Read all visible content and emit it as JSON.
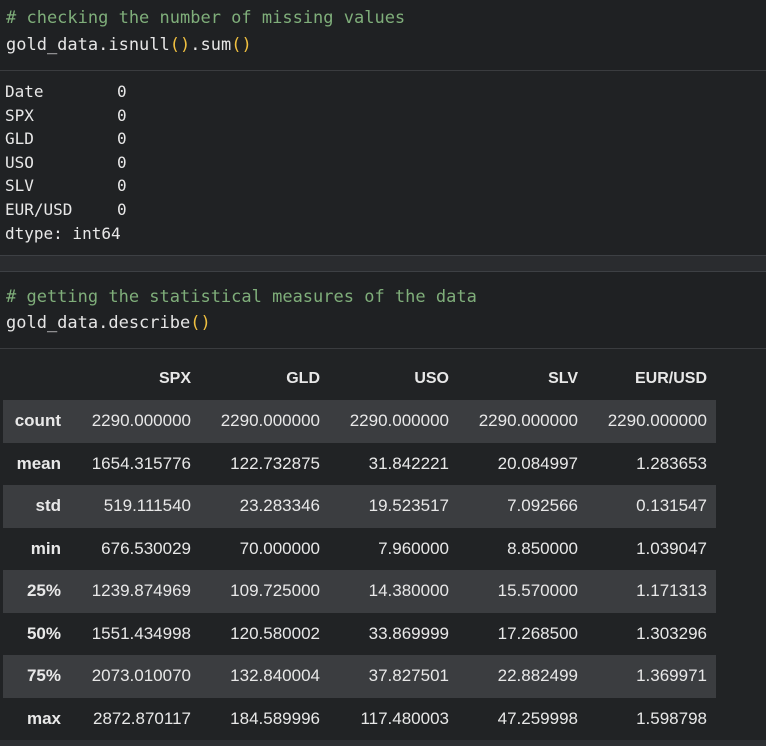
{
  "cell1": {
    "comment": "# checking the number of missing values",
    "code_obj": "gold_data.isnull",
    "code_mid": ".sum",
    "paren": "()"
  },
  "output1": {
    "rows": [
      {
        "name": "Date",
        "value": "0"
      },
      {
        "name": "SPX",
        "value": "0"
      },
      {
        "name": "GLD",
        "value": "0"
      },
      {
        "name": "USO",
        "value": "0"
      },
      {
        "name": "SLV",
        "value": "0"
      },
      {
        "name": "EUR/USD",
        "value": "0"
      }
    ],
    "dtype": "dtype: int64"
  },
  "cell2": {
    "comment": "# getting the statistical measures of the data",
    "code_obj": "gold_data.describe",
    "paren": "()"
  },
  "table": {
    "columns": [
      "SPX",
      "GLD",
      "USO",
      "SLV",
      "EUR/USD"
    ],
    "rows": [
      {
        "label": "count",
        "values": [
          "2290.000000",
          "2290.000000",
          "2290.000000",
          "2290.000000",
          "2290.000000"
        ]
      },
      {
        "label": "mean",
        "values": [
          "1654.315776",
          "122.732875",
          "31.842221",
          "20.084997",
          "1.283653"
        ]
      },
      {
        "label": "std",
        "values": [
          "519.111540",
          "23.283346",
          "19.523517",
          "7.092566",
          "0.131547"
        ]
      },
      {
        "label": "min",
        "values": [
          "676.530029",
          "70.000000",
          "7.960000",
          "8.850000",
          "1.039047"
        ]
      },
      {
        "label": "25%",
        "values": [
          "1239.874969",
          "109.725000",
          "14.380000",
          "15.570000",
          "1.171313"
        ]
      },
      {
        "label": "50%",
        "values": [
          "1551.434998",
          "120.580002",
          "33.869999",
          "17.268500",
          "1.303296"
        ]
      },
      {
        "label": "75%",
        "values": [
          "2073.010070",
          "132.840004",
          "37.827501",
          "22.882499",
          "1.369971"
        ]
      },
      {
        "label": "max",
        "values": [
          "2872.870117",
          "184.589996",
          "117.480003",
          "47.259998",
          "1.598798"
        ]
      }
    ]
  }
}
